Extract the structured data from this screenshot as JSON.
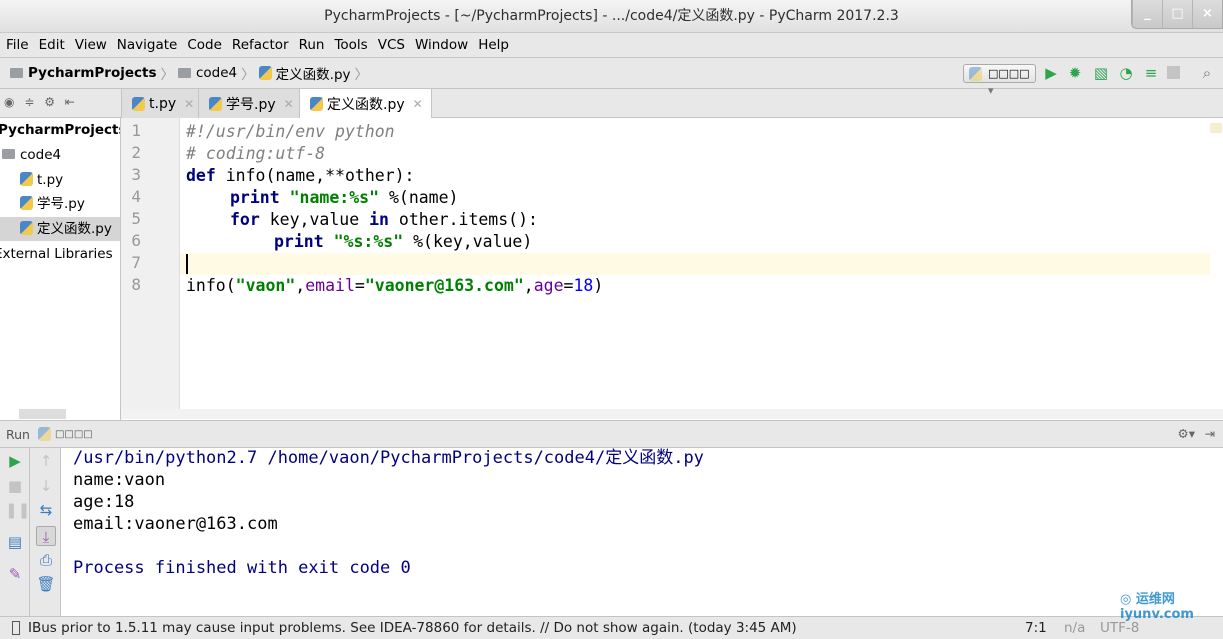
{
  "window": {
    "title": "PycharmProjects - [~/PycharmProjects] - .../code4/定义函数.py - PyCharm 2017.2.3",
    "controls": [
      "_",
      "□",
      "×"
    ]
  },
  "menu": [
    "File",
    "Edit",
    "View",
    "Navigate",
    "Code",
    "Refactor",
    "Run",
    "Tools",
    "VCS",
    "Window",
    "Help"
  ],
  "breadcrumb": [
    "PycharmProjects",
    "code4",
    "定义函数.py"
  ],
  "run_config": "□□□□",
  "tabs": [
    {
      "label": "t.py"
    },
    {
      "label": "学号.py"
    },
    {
      "label": "定义函数.py",
      "active": true
    }
  ],
  "project_tree": [
    "PycharmProjects",
    "code4",
    "t.py",
    "学号.py",
    "定义函数.py",
    "External Libraries"
  ],
  "editor": {
    "line_numbers": [
      "1",
      "2",
      "3",
      "4",
      "5",
      "6",
      "7",
      "8"
    ],
    "lines": {
      "l1": "#!/usr/bin/env python",
      "l2": "# coding:utf-8",
      "l3_kw": "def",
      "l3_rest": " info(name,**other):",
      "l4_kw": "print",
      "l4_str": "\"name:%s\"",
      "l4_rest": " %(name)",
      "l5_kw1": "for",
      "l5_a": " key,value ",
      "l5_kw2": "in",
      "l5_b": " other.items():",
      "l6_kw": "print",
      "l6_str": "\"%s:%s\"",
      "l6_rest": " %(key,value)",
      "l8_a": "info(",
      "l8_s1": "\"vaon\"",
      "l8_c1": ",",
      "l8_k1": "email",
      "l8_eq": "=",
      "l8_s2": "\"vaoner@163.com\"",
      "l8_c2": ",",
      "l8_k2": "age",
      "l8_eq2": "=",
      "l8_n": "18",
      "l8_end": ")"
    }
  },
  "run": {
    "label": "Run",
    "config": "□□□□",
    "output": [
      "/usr/bin/python2.7 /home/vaon/PycharmProjects/code4/定义函数.py",
      "name:vaon",
      "age:18",
      "email:vaoner@163.com",
      "",
      "Process finished with exit code 0"
    ]
  },
  "status": {
    "message": "IBus prior to 1.5.11 may cause input problems. See IDEA-78860 for details. // Do not show again. (today 3:45 AM)",
    "position": "7:1",
    "na": "n/a",
    "encoding": "UTF-8"
  },
  "watermark": "运维网 iyunv.com",
  "colors": {
    "keyword": "#000080",
    "string": "#008000",
    "run_green": "#2ea44f"
  }
}
